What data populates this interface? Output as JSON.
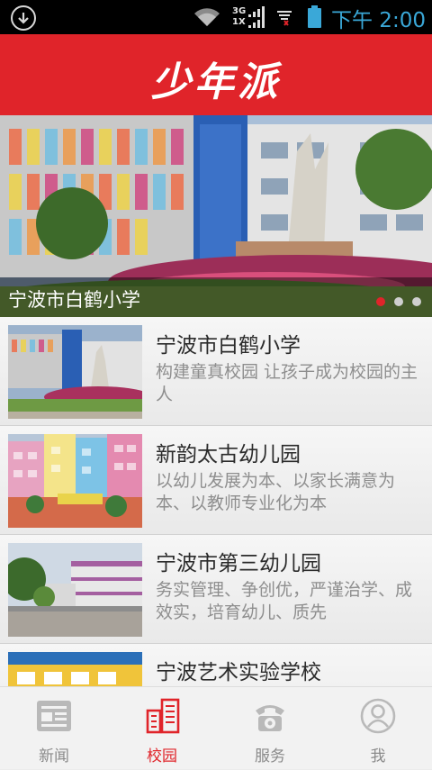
{
  "status_bar": {
    "icons": [
      "download-icon",
      "wifi-icon",
      "signal-icon",
      "sim-icon",
      "battery-icon"
    ],
    "network_3g": "3G",
    "network_1x": "1X",
    "time": "下午 2:00",
    "accent_color": "#3aa8d8"
  },
  "header": {
    "app_title": "少年派",
    "color": "#e0242a"
  },
  "banner": {
    "caption": "宁波市白鹤小学",
    "slide_count": 3,
    "active_slide": 1
  },
  "list": {
    "items": [
      {
        "title": "宁波市白鹤小学",
        "desc": "构建童真校园 让孩子成为校园的主人"
      },
      {
        "title": "新韵太古幼儿园",
        "desc": "以幼儿发展为本、以家长满意为本、以教师专业化为本"
      },
      {
        "title": "宁波市第三幼儿园",
        "desc": "务实管理、争创优，严谨治学、成效实，培育幼儿、质先"
      },
      {
        "title": "宁波艺术实验学校",
        "desc": ""
      }
    ]
  },
  "bottom_nav": {
    "tabs": [
      {
        "label": "新闻",
        "icon": "newspaper-icon"
      },
      {
        "label": "校园",
        "icon": "campus-icon"
      },
      {
        "label": "服务",
        "icon": "phone-icon"
      },
      {
        "label": "我",
        "icon": "user-icon"
      }
    ],
    "active_tab": "校园",
    "active_color": "#e0242a"
  }
}
